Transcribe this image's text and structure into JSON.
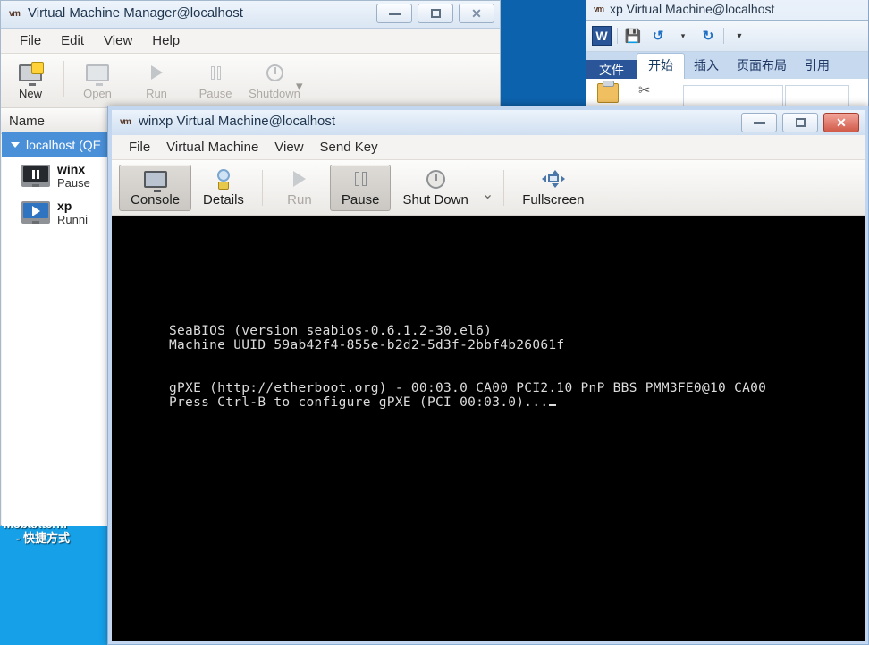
{
  "xp_desktop": {
    "icon_label_line1": "MobaXterm",
    "icon_label_line2": "- 快捷方式"
  },
  "xp_window": {
    "vm_icon": "vm-icon",
    "title": "xp Virtual Machine@localhost",
    "word": {
      "logo": "W",
      "quick_access": [
        {
          "name": "save-icon",
          "glyph": "💾"
        },
        {
          "name": "undo-icon",
          "glyph": "↺"
        },
        {
          "name": "undo-dropdown-icon",
          "glyph": "▾"
        },
        {
          "name": "redo-icon",
          "glyph": "↻"
        },
        {
          "name": "customize-qat-icon",
          "glyph": "▾"
        }
      ],
      "tabs": [
        {
          "label": "文件",
          "state": "file"
        },
        {
          "label": "开始",
          "state": "active"
        },
        {
          "label": "插入",
          "state": "normal"
        },
        {
          "label": "页面布局",
          "state": "normal"
        },
        {
          "label": "引用",
          "state": "normal"
        }
      ]
    }
  },
  "vmm_window": {
    "vm_icon": "vm-icon",
    "title": "Virtual Machine Manager@localhost",
    "window_buttons": {
      "minimize": "minimize-button",
      "maximize": "maximize-button",
      "close": "close-button"
    },
    "menu": [
      "File",
      "Edit",
      "View",
      "Help"
    ],
    "toolbar": [
      {
        "label": "New",
        "icon": "new-vm-icon",
        "enabled": true
      },
      {
        "label": "Open",
        "icon": "open-icon",
        "enabled": false
      },
      {
        "label": "Run",
        "icon": "run-icon",
        "enabled": false
      },
      {
        "label": "Pause",
        "icon": "pause-icon",
        "enabled": false
      },
      {
        "label": "Shutdown",
        "icon": "shutdown-icon",
        "enabled": false
      }
    ],
    "toolbar_dropdown": "▾",
    "column_header": "Name",
    "rows": [
      {
        "type": "host",
        "label": "localhost (QE",
        "selected": true
      },
      {
        "type": "vm",
        "name": "winx",
        "status": "Pause",
        "state": "paused"
      },
      {
        "type": "vm",
        "name": "xp",
        "status": "Runni",
        "state": "running"
      }
    ]
  },
  "winxp_window": {
    "vm_icon": "vm-icon",
    "title": "winxp Virtual Machine@localhost",
    "window_buttons": {
      "minimize": "minimize-button",
      "maximize": "maximize-button",
      "close": "close-button"
    },
    "menu": [
      "File",
      "Virtual Machine",
      "View",
      "Send Key"
    ],
    "toolbar": [
      {
        "label": "Console",
        "icon": "console-icon",
        "active": true,
        "enabled": true
      },
      {
        "label": "Details",
        "icon": "details-icon",
        "active": false,
        "enabled": true
      },
      {
        "label": "Run",
        "icon": "run-icon",
        "active": false,
        "enabled": false
      },
      {
        "label": "Pause",
        "icon": "pause-icon",
        "active": true,
        "enabled": true
      },
      {
        "label": "Shut Down",
        "icon": "shutdown-icon",
        "active": false,
        "enabled": true
      },
      {
        "label": "Fullscreen",
        "icon": "fullscreen-icon",
        "active": false,
        "enabled": true
      }
    ],
    "shutdown_dropdown": "⌄",
    "console": {
      "lines": [
        "SeaBIOS (version seabios-0.6.1.2-30.el6)",
        "Machine UUID 59ab42f4-855e-b2d2-5d3f-2bbf4b26061f",
        "",
        "",
        "gPXE (http://etherboot.org) - 00:03.0 CA00 PCI2.10 PnP BBS PMM3FE0@10 CA00",
        "Press Ctrl-B to configure gPXE (PCI 00:03.0)..."
      ]
    }
  },
  "colors": {
    "desktop_blue": "#0d62ad",
    "desktop_cyan": "#15a0e8",
    "selection_blue": "#4a90d9",
    "word_blue": "#2a5699",
    "close_red": "#d05a49",
    "console_bg": "#000000",
    "console_fg": "#dcdcdc"
  }
}
